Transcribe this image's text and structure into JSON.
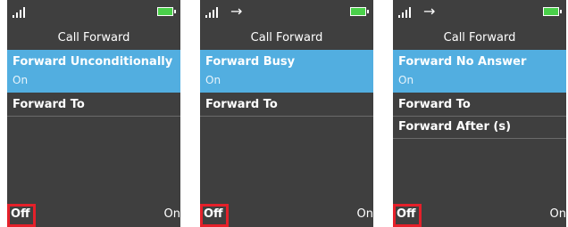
{
  "screens": [
    {
      "title": "Call Forward",
      "status": {
        "show_arrow": false,
        "arrow_glyph": "→"
      },
      "selected": {
        "label": "Forward Unconditionally",
        "value": "On"
      },
      "items": [
        "Forward To"
      ],
      "softkeys": {
        "left": "Off",
        "right": "On"
      }
    },
    {
      "title": "Call Forward",
      "status": {
        "show_arrow": true,
        "arrow_glyph": "→"
      },
      "selected": {
        "label": "Forward Busy",
        "value": "On"
      },
      "items": [
        "Forward To"
      ],
      "softkeys": {
        "left": "Off",
        "right": "On"
      }
    },
    {
      "title": "Call Forward",
      "status": {
        "show_arrow": true,
        "arrow_glyph": "→"
      },
      "selected": {
        "label": "Forward No Answer",
        "value": "On"
      },
      "items": [
        "Forward To",
        "Forward After (s)"
      ],
      "softkeys": {
        "left": "Off",
        "right": "On"
      }
    }
  ],
  "colors": {
    "screen_bg": "#3f3f3f",
    "selection": "#52aee0",
    "highlight_box": "#e5202a",
    "battery": "#4ad04a"
  },
  "icons": {
    "signal": "signal-strength-icon",
    "arrow": "call-forward-arrow-icon",
    "battery": "battery-icon"
  }
}
